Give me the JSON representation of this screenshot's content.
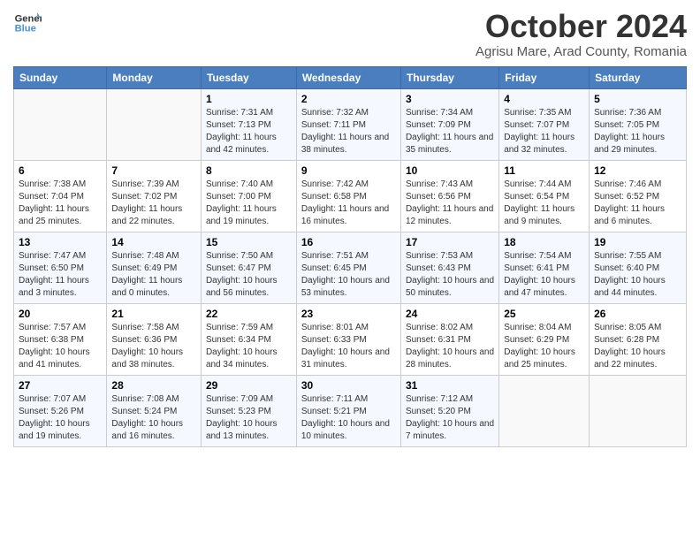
{
  "header": {
    "logo_line1": "General",
    "logo_line2": "Blue",
    "month_title": "October 2024",
    "subtitle": "Agrisu Mare, Arad County, Romania"
  },
  "days_of_week": [
    "Sunday",
    "Monday",
    "Tuesday",
    "Wednesday",
    "Thursday",
    "Friday",
    "Saturday"
  ],
  "weeks": [
    [
      {
        "day": "",
        "info": ""
      },
      {
        "day": "",
        "info": ""
      },
      {
        "day": "1",
        "info": "Sunrise: 7:31 AM\nSunset: 7:13 PM\nDaylight: 11 hours and 42 minutes."
      },
      {
        "day": "2",
        "info": "Sunrise: 7:32 AM\nSunset: 7:11 PM\nDaylight: 11 hours and 38 minutes."
      },
      {
        "day": "3",
        "info": "Sunrise: 7:34 AM\nSunset: 7:09 PM\nDaylight: 11 hours and 35 minutes."
      },
      {
        "day": "4",
        "info": "Sunrise: 7:35 AM\nSunset: 7:07 PM\nDaylight: 11 hours and 32 minutes."
      },
      {
        "day": "5",
        "info": "Sunrise: 7:36 AM\nSunset: 7:05 PM\nDaylight: 11 hours and 29 minutes."
      }
    ],
    [
      {
        "day": "6",
        "info": "Sunrise: 7:38 AM\nSunset: 7:04 PM\nDaylight: 11 hours and 25 minutes."
      },
      {
        "day": "7",
        "info": "Sunrise: 7:39 AM\nSunset: 7:02 PM\nDaylight: 11 hours and 22 minutes."
      },
      {
        "day": "8",
        "info": "Sunrise: 7:40 AM\nSunset: 7:00 PM\nDaylight: 11 hours and 19 minutes."
      },
      {
        "day": "9",
        "info": "Sunrise: 7:42 AM\nSunset: 6:58 PM\nDaylight: 11 hours and 16 minutes."
      },
      {
        "day": "10",
        "info": "Sunrise: 7:43 AM\nSunset: 6:56 PM\nDaylight: 11 hours and 12 minutes."
      },
      {
        "day": "11",
        "info": "Sunrise: 7:44 AM\nSunset: 6:54 PM\nDaylight: 11 hours and 9 minutes."
      },
      {
        "day": "12",
        "info": "Sunrise: 7:46 AM\nSunset: 6:52 PM\nDaylight: 11 hours and 6 minutes."
      }
    ],
    [
      {
        "day": "13",
        "info": "Sunrise: 7:47 AM\nSunset: 6:50 PM\nDaylight: 11 hours and 3 minutes."
      },
      {
        "day": "14",
        "info": "Sunrise: 7:48 AM\nSunset: 6:49 PM\nDaylight: 11 hours and 0 minutes."
      },
      {
        "day": "15",
        "info": "Sunrise: 7:50 AM\nSunset: 6:47 PM\nDaylight: 10 hours and 56 minutes."
      },
      {
        "day": "16",
        "info": "Sunrise: 7:51 AM\nSunset: 6:45 PM\nDaylight: 10 hours and 53 minutes."
      },
      {
        "day": "17",
        "info": "Sunrise: 7:53 AM\nSunset: 6:43 PM\nDaylight: 10 hours and 50 minutes."
      },
      {
        "day": "18",
        "info": "Sunrise: 7:54 AM\nSunset: 6:41 PM\nDaylight: 10 hours and 47 minutes."
      },
      {
        "day": "19",
        "info": "Sunrise: 7:55 AM\nSunset: 6:40 PM\nDaylight: 10 hours and 44 minutes."
      }
    ],
    [
      {
        "day": "20",
        "info": "Sunrise: 7:57 AM\nSunset: 6:38 PM\nDaylight: 10 hours and 41 minutes."
      },
      {
        "day": "21",
        "info": "Sunrise: 7:58 AM\nSunset: 6:36 PM\nDaylight: 10 hours and 38 minutes."
      },
      {
        "day": "22",
        "info": "Sunrise: 7:59 AM\nSunset: 6:34 PM\nDaylight: 10 hours and 34 minutes."
      },
      {
        "day": "23",
        "info": "Sunrise: 8:01 AM\nSunset: 6:33 PM\nDaylight: 10 hours and 31 minutes."
      },
      {
        "day": "24",
        "info": "Sunrise: 8:02 AM\nSunset: 6:31 PM\nDaylight: 10 hours and 28 minutes."
      },
      {
        "day": "25",
        "info": "Sunrise: 8:04 AM\nSunset: 6:29 PM\nDaylight: 10 hours and 25 minutes."
      },
      {
        "day": "26",
        "info": "Sunrise: 8:05 AM\nSunset: 6:28 PM\nDaylight: 10 hours and 22 minutes."
      }
    ],
    [
      {
        "day": "27",
        "info": "Sunrise: 7:07 AM\nSunset: 5:26 PM\nDaylight: 10 hours and 19 minutes."
      },
      {
        "day": "28",
        "info": "Sunrise: 7:08 AM\nSunset: 5:24 PM\nDaylight: 10 hours and 16 minutes."
      },
      {
        "day": "29",
        "info": "Sunrise: 7:09 AM\nSunset: 5:23 PM\nDaylight: 10 hours and 13 minutes."
      },
      {
        "day": "30",
        "info": "Sunrise: 7:11 AM\nSunset: 5:21 PM\nDaylight: 10 hours and 10 minutes."
      },
      {
        "day": "31",
        "info": "Sunrise: 7:12 AM\nSunset: 5:20 PM\nDaylight: 10 hours and 7 minutes."
      },
      {
        "day": "",
        "info": ""
      },
      {
        "day": "",
        "info": ""
      }
    ]
  ]
}
